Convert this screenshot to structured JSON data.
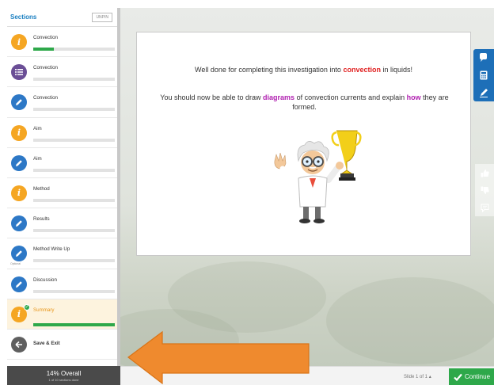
{
  "sidebar": {
    "title": "Sections",
    "unpin_label": "UNPIN",
    "items": [
      {
        "label": "Convection",
        "icon": "info-icon",
        "progress": 0.25
      },
      {
        "label": "Convection",
        "icon": "list-icon",
        "progress": 0
      },
      {
        "label": "Convection",
        "icon": "pencil-icon",
        "progress": 0
      },
      {
        "label": "Aim",
        "icon": "info-icon",
        "progress": 0
      },
      {
        "label": "Aim",
        "icon": "pencil-icon",
        "progress": 0
      },
      {
        "label": "Method",
        "icon": "info-icon",
        "progress": 0
      },
      {
        "label": "Results",
        "icon": "pencil-icon",
        "progress": 0
      },
      {
        "label": "Method Write Up",
        "icon": "pencil-icon",
        "progress": 0,
        "tag": "Optional"
      },
      {
        "label": "Discussion",
        "icon": "pencil-icon",
        "progress": 0
      },
      {
        "label": "Summary",
        "icon": "info-icon",
        "progress": 1.0,
        "active": true
      }
    ],
    "exit_label": "Save & Exit",
    "footer": {
      "overall": "14% Overall",
      "sections_done": "1 of 10 sections done"
    }
  },
  "slide": {
    "line1": {
      "before": "Well done for completing this investigation into ",
      "highlight": "convection",
      "after": " in liquids!"
    },
    "line2": {
      "part1": "You should now be able to draw ",
      "highlight1": "diagrams",
      "part2": " of convection currents and explain ",
      "highlight2": "how",
      "part3": " they are formed."
    }
  },
  "bottombar": {
    "slide_counter": "Slide 1 of 1",
    "continue_label": "Continue"
  },
  "colors": {
    "accent_blue": "#1d6fb8",
    "info_orange": "#f5a623",
    "progress_green": "#2ea84a",
    "highlight_red": "#e02020",
    "highlight_purple": "#b020b0",
    "arrow_orange": "#ef8a2e"
  }
}
